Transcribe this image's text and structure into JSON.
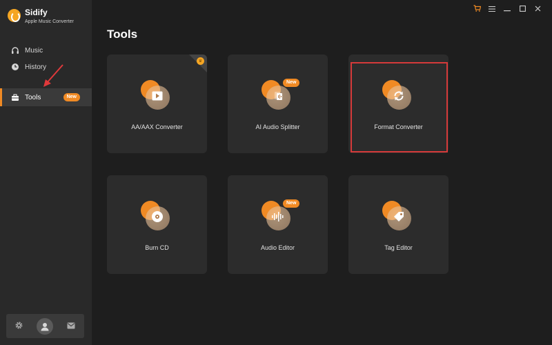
{
  "app": {
    "name": "Sidify",
    "subtitle": "Apple Music Converter"
  },
  "sidebar": {
    "items": [
      {
        "label": "Music",
        "icon": "headphones-icon"
      },
      {
        "label": "History",
        "icon": "clock-icon"
      },
      {
        "label": "Tools",
        "icon": "toolbox-icon",
        "badge": "New",
        "active": true
      }
    ],
    "bottom": [
      "gear-icon",
      "user-avatar",
      "mail-icon"
    ]
  },
  "window_controls": [
    "cart-icon",
    "menu-icon",
    "minimize-icon",
    "maximize-icon",
    "close-icon"
  ],
  "main": {
    "title": "Tools",
    "tools": [
      {
        "label": "AA/AAX Converter",
        "icon": "video-play-icon"
      },
      {
        "label": "AI Audio Splitter",
        "icon": "audio-split-icon",
        "badge": "New"
      },
      {
        "label": "Format Converter",
        "icon": "refresh-icon",
        "highlighted": true
      },
      {
        "label": "Burn CD",
        "icon": "disc-icon"
      },
      {
        "label": "Audio Editor",
        "icon": "waveform-icon",
        "badge": "New"
      },
      {
        "label": "Tag Editor",
        "icon": "tag-icon"
      }
    ]
  },
  "colors": {
    "accent": "#f08a24",
    "highlight": "#d63a3a",
    "background": "#1e1e1e",
    "sidebar": "#292929",
    "card": "#2c2c2c"
  }
}
